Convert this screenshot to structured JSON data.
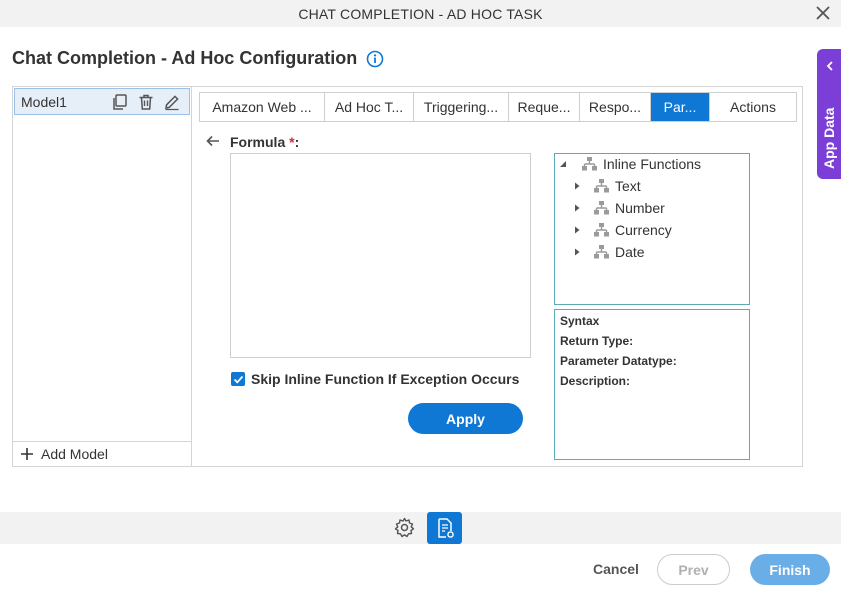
{
  "window": {
    "title": "CHAT COMPLETION - AD HOC TASK"
  },
  "page": {
    "heading": "Chat Completion - Ad Hoc Configuration"
  },
  "side_panel": {
    "label": "App Data"
  },
  "models": {
    "items": [
      "Model1"
    ],
    "add_label": "Add Model"
  },
  "tabs": [
    {
      "label": "Amazon Web ...",
      "active": false
    },
    {
      "label": "Ad Hoc T...",
      "active": false
    },
    {
      "label": "Triggering...",
      "active": false
    },
    {
      "label": "Reque...",
      "active": false
    },
    {
      "label": "Respo...",
      "active": false
    },
    {
      "label": "Par...",
      "active": true
    },
    {
      "label": "Actions",
      "active": false
    }
  ],
  "formula": {
    "label": "Formula",
    "required_mark": "*",
    "label_suffix": ":",
    "value": ""
  },
  "skip_option": {
    "label": "Skip Inline Function If Exception Occurs",
    "checked": true
  },
  "apply_label": "Apply",
  "tree": {
    "root": "Inline Functions",
    "children": [
      "Text",
      "Number",
      "Currency",
      "Date"
    ]
  },
  "syntax_panel": {
    "syntax": "Syntax",
    "return_type": "Return Type:",
    "parameter_datatype": "Parameter Datatype:",
    "description": "Description:"
  },
  "footer": {
    "cancel": "Cancel",
    "prev": "Prev",
    "finish": "Finish"
  },
  "colors": {
    "accent": "#0f78d4",
    "app_data": "#7b3fd8",
    "panel_border": "#5aaab8",
    "required": "#d9262c"
  }
}
